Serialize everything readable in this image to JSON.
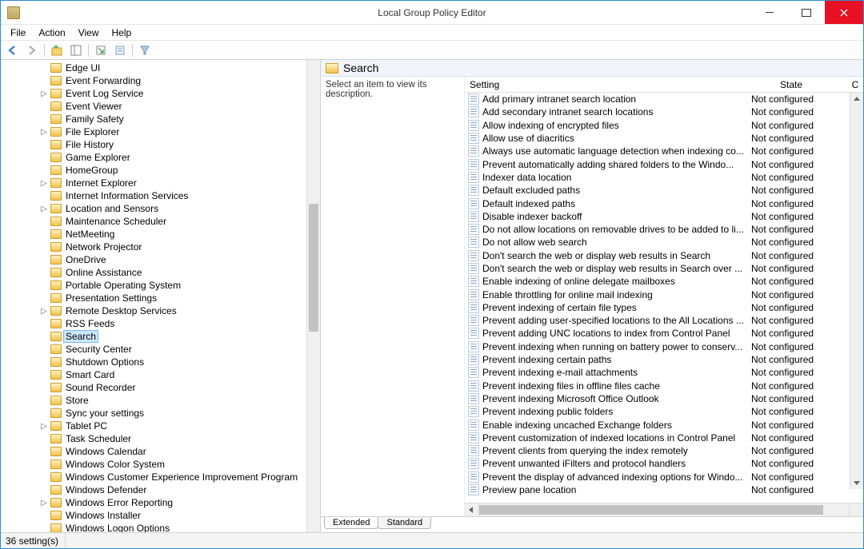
{
  "window": {
    "title": "Local Group Policy Editor"
  },
  "menubar": [
    "File",
    "Action",
    "View",
    "Help"
  ],
  "tree": {
    "selected": "Search",
    "items": [
      {
        "label": "Edge UI",
        "exp": ""
      },
      {
        "label": "Event Forwarding",
        "exp": ""
      },
      {
        "label": "Event Log Service",
        "exp": "▷"
      },
      {
        "label": "Event Viewer",
        "exp": ""
      },
      {
        "label": "Family Safety",
        "exp": ""
      },
      {
        "label": "File Explorer",
        "exp": "▷"
      },
      {
        "label": "File History",
        "exp": ""
      },
      {
        "label": "Game Explorer",
        "exp": ""
      },
      {
        "label": "HomeGroup",
        "exp": ""
      },
      {
        "label": "Internet Explorer",
        "exp": "▷"
      },
      {
        "label": "Internet Information Services",
        "exp": ""
      },
      {
        "label": "Location and Sensors",
        "exp": "▷"
      },
      {
        "label": "Maintenance Scheduler",
        "exp": ""
      },
      {
        "label": "NetMeeting",
        "exp": ""
      },
      {
        "label": "Network Projector",
        "exp": ""
      },
      {
        "label": "OneDrive",
        "exp": ""
      },
      {
        "label": "Online Assistance",
        "exp": ""
      },
      {
        "label": "Portable Operating System",
        "exp": ""
      },
      {
        "label": "Presentation Settings",
        "exp": ""
      },
      {
        "label": "Remote Desktop Services",
        "exp": "▷"
      },
      {
        "label": "RSS Feeds",
        "exp": ""
      },
      {
        "label": "Search",
        "exp": ""
      },
      {
        "label": "Security Center",
        "exp": ""
      },
      {
        "label": "Shutdown Options",
        "exp": ""
      },
      {
        "label": "Smart Card",
        "exp": ""
      },
      {
        "label": "Sound Recorder",
        "exp": ""
      },
      {
        "label": "Store",
        "exp": ""
      },
      {
        "label": "Sync your settings",
        "exp": ""
      },
      {
        "label": "Tablet PC",
        "exp": "▷"
      },
      {
        "label": "Task Scheduler",
        "exp": ""
      },
      {
        "label": "Windows Calendar",
        "exp": ""
      },
      {
        "label": "Windows Color System",
        "exp": ""
      },
      {
        "label": "Windows Customer Experience Improvement Program",
        "exp": ""
      },
      {
        "label": "Windows Defender",
        "exp": ""
      },
      {
        "label": "Windows Error Reporting",
        "exp": "▷"
      },
      {
        "label": "Windows Installer",
        "exp": ""
      },
      {
        "label": "Windows Logon Options",
        "exp": ""
      }
    ]
  },
  "details": {
    "heading": "Search",
    "description": "Select an item to view its description.",
    "columns": {
      "setting": "Setting",
      "state": "State",
      "c": "C"
    },
    "settings": [
      {
        "name": "Add primary intranet search location",
        "state": "Not configured"
      },
      {
        "name": "Add secondary intranet search locations",
        "state": "Not configured"
      },
      {
        "name": "Allow indexing of encrypted files",
        "state": "Not configured"
      },
      {
        "name": "Allow use of diacritics",
        "state": "Not configured"
      },
      {
        "name": "Always use automatic language detection when indexing co...",
        "state": "Not configured"
      },
      {
        "name": "Prevent automatically adding shared folders to the Windo...",
        "state": "Not configured"
      },
      {
        "name": "Indexer data location",
        "state": "Not configured"
      },
      {
        "name": "Default excluded paths",
        "state": "Not configured"
      },
      {
        "name": "Default indexed paths",
        "state": "Not configured"
      },
      {
        "name": "Disable indexer backoff",
        "state": "Not configured"
      },
      {
        "name": "Do not allow locations on removable drives to be added to li...",
        "state": "Not configured"
      },
      {
        "name": "Do not allow web search",
        "state": "Not configured"
      },
      {
        "name": "Don't search the web or display web results in Search",
        "state": "Not configured"
      },
      {
        "name": "Don't search the web or display web results in Search over ...",
        "state": "Not configured"
      },
      {
        "name": "Enable indexing of online delegate mailboxes",
        "state": "Not configured"
      },
      {
        "name": "Enable throttling for online mail indexing",
        "state": "Not configured"
      },
      {
        "name": "Prevent indexing of certain file types",
        "state": "Not configured"
      },
      {
        "name": "Prevent adding user-specified locations to the All Locations ...",
        "state": "Not configured"
      },
      {
        "name": "Prevent adding UNC locations to index from Control Panel",
        "state": "Not configured"
      },
      {
        "name": "Prevent indexing when running on battery power to conserv...",
        "state": "Not configured"
      },
      {
        "name": "Prevent indexing certain paths",
        "state": "Not configured"
      },
      {
        "name": "Prevent indexing e-mail attachments",
        "state": "Not configured"
      },
      {
        "name": "Prevent indexing files in offline files cache",
        "state": "Not configured"
      },
      {
        "name": "Prevent indexing Microsoft Office Outlook",
        "state": "Not configured"
      },
      {
        "name": "Prevent indexing public folders",
        "state": "Not configured"
      },
      {
        "name": "Enable indexing uncached Exchange folders",
        "state": "Not configured"
      },
      {
        "name": "Prevent customization of indexed locations in Control Panel",
        "state": "Not configured"
      },
      {
        "name": "Prevent clients from querying the index remotely",
        "state": "Not configured"
      },
      {
        "name": "Prevent unwanted iFilters and protocol handlers",
        "state": "Not configured"
      },
      {
        "name": "Prevent the display of advanced indexing options for Windo...",
        "state": "Not configured"
      },
      {
        "name": "Preview pane location",
        "state": "Not configured"
      }
    ]
  },
  "tabs": {
    "extended": "Extended",
    "standard": "Standard"
  },
  "statusbar": {
    "text": "36 setting(s)"
  }
}
